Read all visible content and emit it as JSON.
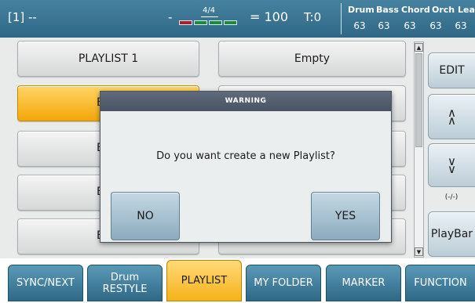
{
  "header": {
    "song": "[1] --",
    "dash": "-",
    "time_signature": "4/4",
    "beat_colors": [
      "#b01c2b",
      "#1a8b3a",
      "#1a8b3a",
      "#1a8b3a"
    ],
    "tempo": "= 100",
    "transpose": "T:0",
    "volumes": [
      {
        "label": "Drum",
        "value": "63"
      },
      {
        "label": "Bass",
        "value": "63"
      },
      {
        "label": "Chord",
        "value": "63"
      },
      {
        "label": "Orch",
        "value": "63"
      },
      {
        "label": "Lea",
        "value": "63"
      }
    ]
  },
  "slots": [
    {
      "label": "PLAYLIST 1"
    },
    {
      "label": "Empty"
    },
    {
      "label": "Er"
    },
    {
      "label": "Er"
    },
    {
      "label": "Er"
    },
    {
      "label": "Er"
    }
  ],
  "side": {
    "edit_label": "EDIT",
    "up_icon": "double-chevron-up",
    "down_icon": "double-chevron-down",
    "hint": "(-/-)",
    "playbar_label": "PlayBar"
  },
  "dialog": {
    "title": "WARNING",
    "message": "Do you want create a new Playlist?",
    "no_label": "NO",
    "yes_label": "YES"
  },
  "tabs": [
    {
      "label": "SYNC/NEXT"
    },
    {
      "label_line1": "Drum",
      "label_line2": "RESTYLE"
    },
    {
      "label": "PLAYLIST",
      "active": true
    },
    {
      "label": "MY FOLDER"
    },
    {
      "label": "MARKER"
    },
    {
      "label": "FUNCTION"
    }
  ],
  "colors": {
    "header_bg": "#3a7592",
    "selected": "#f5b318",
    "tab_bg": "#3c7b9b",
    "dialog_title_bg": "#515d6c"
  }
}
